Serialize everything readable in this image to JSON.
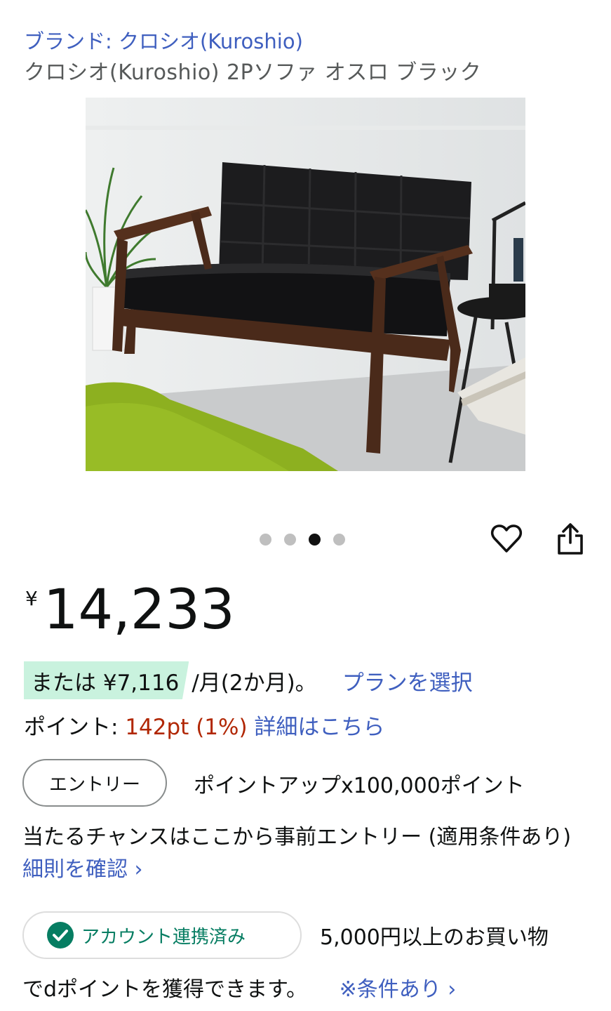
{
  "brand": {
    "link": "ブランド: クロシオ(Kuroshio)"
  },
  "product": {
    "title": "クロシオ(Kuroshio) 2Pソファ オスロ ブラック"
  },
  "gallery": {
    "dot_count": 4,
    "active_dot": 3,
    "icons": [
      "heart-icon",
      "share-icon"
    ]
  },
  "price": {
    "currency": "¥",
    "value": "14,233"
  },
  "installment": {
    "prefix": "または ¥7,116",
    "suffix": "/月(2か月)。",
    "link": "プランを選択"
  },
  "points": {
    "label": "ポイント: ",
    "value": "142pt",
    "percent": "(1%)",
    "link": "詳細はこちら"
  },
  "entry": {
    "button": "エントリー",
    "line1": "ポイントアップx100,000ポイント",
    "line2": "当たるチャンスはここから事前エントリー (適用条件あり)",
    "link": "細則を確認 ›"
  },
  "dpoint": {
    "badge": "アカウント連携済み",
    "line1": "5,000円以上のお買い物",
    "line2": "でdポイントを獲得できます。",
    "link": "※条件あり ›"
  },
  "colors": {
    "link": "#3f5fbf",
    "price_red": "#b12704",
    "installment_bg": "#c9f2de",
    "badge_green": "#067d62"
  }
}
